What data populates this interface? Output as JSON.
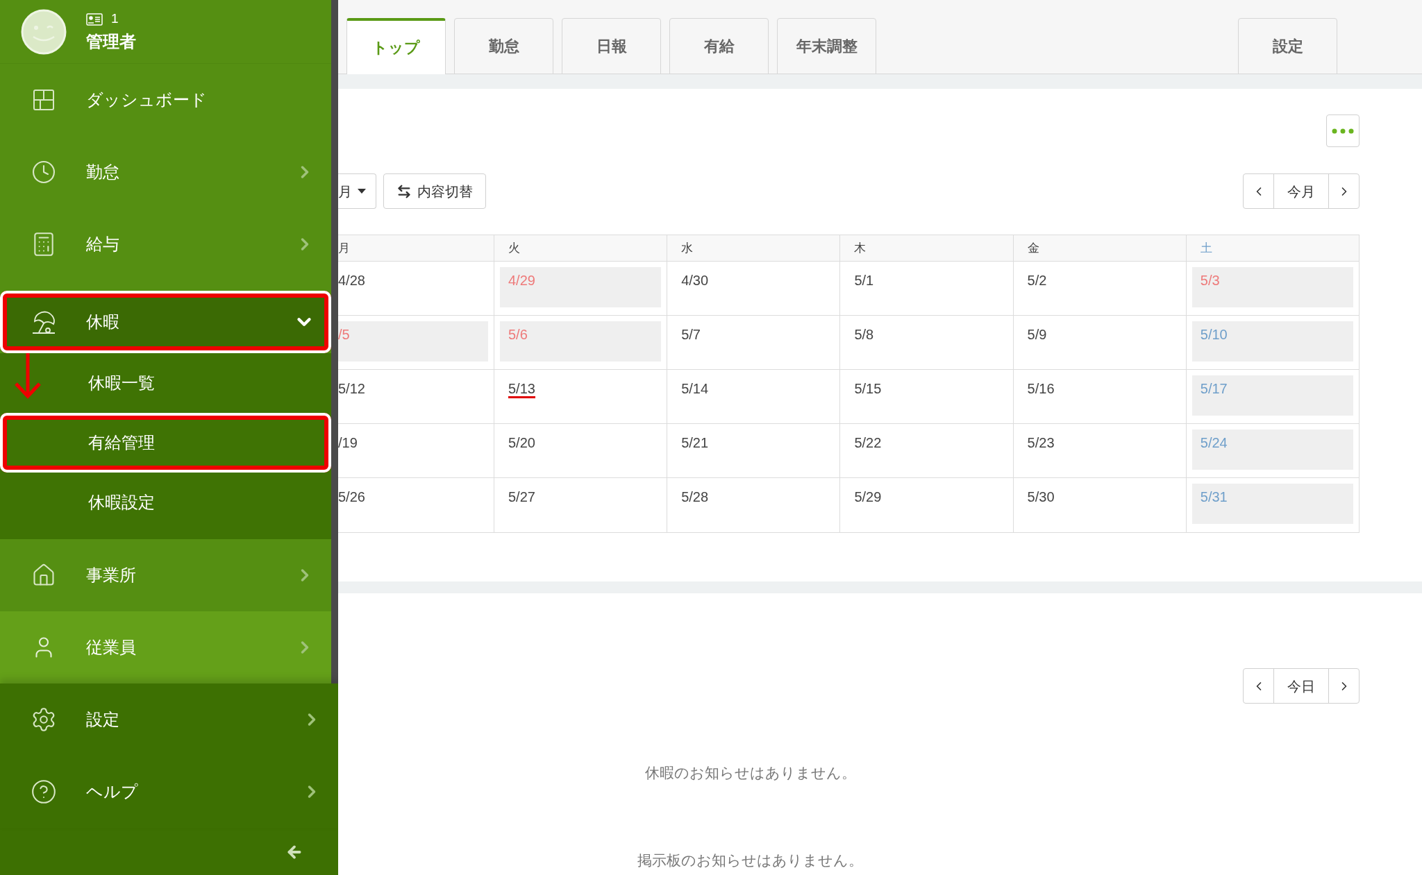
{
  "sidebar": {
    "user": {
      "id": "1",
      "name": "管理者"
    },
    "items": [
      {
        "label": "ダッシュボード",
        "kind": "link",
        "expanded": false,
        "highlighted": false,
        "framed": false
      },
      {
        "label": "勤怠",
        "kind": "group",
        "expanded": false,
        "highlighted": false,
        "framed": false
      },
      {
        "label": "給与",
        "kind": "group",
        "expanded": false,
        "highlighted": false,
        "framed": false
      },
      {
        "label": "休暇",
        "kind": "group",
        "expanded": true,
        "highlighted": false,
        "framed": true,
        "children": [
          {
            "label": "休暇一覧",
            "framed": false,
            "arrow": true
          },
          {
            "label": "有給管理",
            "framed": true,
            "arrow": false
          },
          {
            "label": "休暇設定",
            "framed": false,
            "arrow": false
          }
        ]
      },
      {
        "label": "事業所",
        "kind": "group",
        "expanded": false,
        "highlighted": false,
        "framed": false
      },
      {
        "label": "従業員",
        "kind": "group",
        "expanded": false,
        "highlighted": true,
        "framed": false
      }
    ],
    "footer_items": [
      {
        "label": "設定",
        "kind": "group",
        "expanded": false
      },
      {
        "label": "ヘルプ",
        "kind": "group",
        "expanded": false
      }
    ]
  },
  "tabs": [
    {
      "label": "トップ",
      "selected": true
    },
    {
      "label": "勤怠",
      "selected": false
    },
    {
      "label": "日報",
      "selected": false
    },
    {
      "label": "有給",
      "selected": false
    },
    {
      "label": "年末調整",
      "selected": false
    }
  ],
  "settings_tab": {
    "label": "設定",
    "selected": false
  },
  "calendar": {
    "view_select": "月",
    "toggle_button": "内容切替",
    "nav_label": "今月",
    "columns": [
      {
        "label": "月",
        "kind": "normal"
      },
      {
        "label": "火",
        "kind": "normal"
      },
      {
        "label": "水",
        "kind": "normal"
      },
      {
        "label": "木",
        "kind": "normal"
      },
      {
        "label": "金",
        "kind": "normal"
      },
      {
        "label": "土",
        "kind": "saturday"
      }
    ],
    "rows": [
      [
        {
          "label": "4/28",
          "kind": "normal"
        },
        {
          "label": "4/29",
          "kind": "holiday"
        },
        {
          "label": "4/30",
          "kind": "normal"
        },
        {
          "label": "5/1",
          "kind": "normal"
        },
        {
          "label": "5/2",
          "kind": "normal"
        },
        {
          "label": "5/3",
          "kind": "holiday"
        }
      ],
      [
        {
          "label": "/5",
          "kind": "holiday"
        },
        {
          "label": "5/6",
          "kind": "holiday"
        },
        {
          "label": "5/7",
          "kind": "normal"
        },
        {
          "label": "5/8",
          "kind": "normal"
        },
        {
          "label": "5/9",
          "kind": "normal"
        },
        {
          "label": "5/10",
          "kind": "saturday"
        }
      ],
      [
        {
          "label": "5/12",
          "kind": "normal"
        },
        {
          "label": "5/13",
          "kind": "today"
        },
        {
          "label": "5/14",
          "kind": "normal"
        },
        {
          "label": "5/15",
          "kind": "normal"
        },
        {
          "label": "5/16",
          "kind": "normal"
        },
        {
          "label": "5/17",
          "kind": "saturday"
        }
      ],
      [
        {
          "label": "/19",
          "kind": "normal"
        },
        {
          "label": "5/20",
          "kind": "normal"
        },
        {
          "label": "5/21",
          "kind": "normal"
        },
        {
          "label": "5/22",
          "kind": "normal"
        },
        {
          "label": "5/23",
          "kind": "normal"
        },
        {
          "label": "5/24",
          "kind": "saturday"
        }
      ],
      [
        {
          "label": "5/26",
          "kind": "normal"
        },
        {
          "label": "5/27",
          "kind": "normal"
        },
        {
          "label": "5/28",
          "kind": "normal"
        },
        {
          "label": "5/29",
          "kind": "normal"
        },
        {
          "label": "5/30",
          "kind": "normal"
        },
        {
          "label": "5/31",
          "kind": "saturday"
        }
      ]
    ]
  },
  "notices": {
    "nav_label": "今日",
    "messages": [
      "休暇のお知らせはありません。",
      "掲示板のお知らせはありません。"
    ]
  }
}
